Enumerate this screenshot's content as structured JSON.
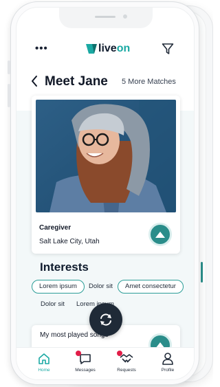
{
  "header": {
    "menu_glyph": "•••",
    "logo_part1": "live",
    "logo_part2": "on",
    "page_title": "Meet Jane",
    "more_matches": "5 More Matches"
  },
  "profile": {
    "role": "Caregiver",
    "location": "Salt Lake City, Utah"
  },
  "interests": {
    "heading": "Interests",
    "selected_chips": [
      "Lorem ipsum",
      "Amet consectetur"
    ],
    "tags": [
      "Dolor sit",
      "Dolor sit",
      "Lorem ipsum"
    ]
  },
  "section2": {
    "title": "My most played songs"
  },
  "tabbar": {
    "items": [
      {
        "label": "Home",
        "icon": "home-icon",
        "active": true
      },
      {
        "label": "Messages",
        "icon": "chat-icon",
        "badge": true
      },
      {
        "label": "Requests",
        "icon": "handshake-icon",
        "badge": true
      },
      {
        "label": "Profile",
        "icon": "person-icon"
      }
    ]
  },
  "colors": {
    "accent": "#2a8d8a",
    "accent_light": "#1aa9a3",
    "badge": "#e11d48",
    "dark": "#1f2a37"
  }
}
